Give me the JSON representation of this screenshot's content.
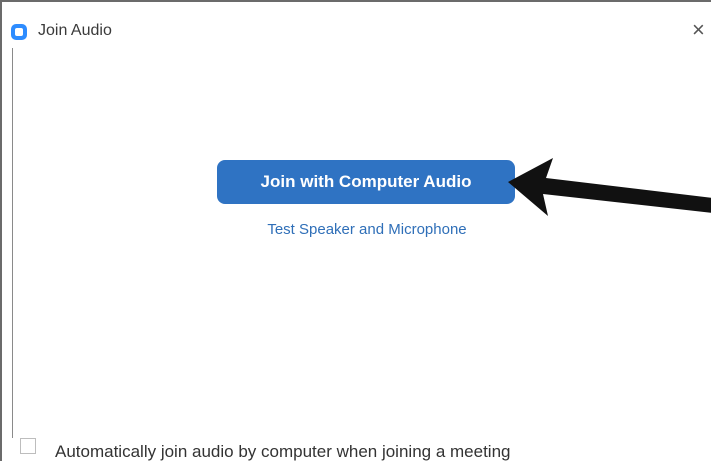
{
  "window": {
    "title": "Join Audio",
    "close_glyph": "×",
    "app_icon": "zoom-icon"
  },
  "main": {
    "join_button_label": "Join with Computer Audio",
    "test_link_label": "Test Speaker and Microphone"
  },
  "footer": {
    "auto_join_label": "Automatically join audio by computer when joining a meeting",
    "auto_join_checked": false
  },
  "annotation": {
    "arrow_icon": "arrow-left-icon"
  },
  "colors": {
    "accent": "#2f73c3",
    "link": "#2f6fb8"
  }
}
